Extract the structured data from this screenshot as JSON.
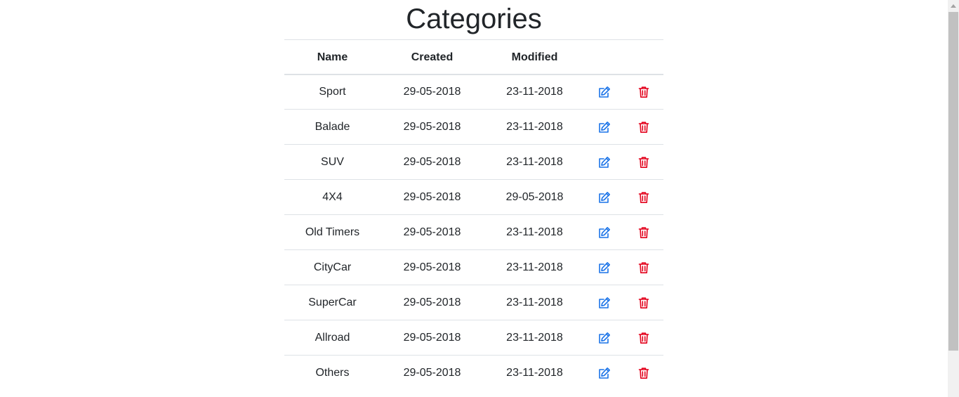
{
  "page": {
    "title": "Categories"
  },
  "table": {
    "headers": {
      "name": "Name",
      "created": "Created",
      "modified": "Modified"
    },
    "rows": [
      {
        "name": "Sport",
        "created": "29-05-2018",
        "modified": "23-11-2018"
      },
      {
        "name": "Balade",
        "created": "29-05-2018",
        "modified": "23-11-2018"
      },
      {
        "name": "SUV",
        "created": "29-05-2018",
        "modified": "23-11-2018"
      },
      {
        "name": "4X4",
        "created": "29-05-2018",
        "modified": "29-05-2018"
      },
      {
        "name": "Old Timers",
        "created": "29-05-2018",
        "modified": "23-11-2018"
      },
      {
        "name": "CityCar",
        "created": "29-05-2018",
        "modified": "23-11-2018"
      },
      {
        "name": "SuperCar",
        "created": "29-05-2018",
        "modified": "23-11-2018"
      },
      {
        "name": "Allroad",
        "created": "29-05-2018",
        "modified": "23-11-2018"
      },
      {
        "name": "Others",
        "created": "29-05-2018",
        "modified": "23-11-2018"
      }
    ],
    "row_actions": [
      {
        "icon": "edit-icon",
        "color": "#1a73e8"
      },
      {
        "icon": "trash-icon",
        "color": "#e3001b"
      }
    ]
  },
  "colors": {
    "text": "#212529",
    "border": "#dee2e6",
    "edit": "#1a73e8",
    "delete": "#e3001b"
  }
}
